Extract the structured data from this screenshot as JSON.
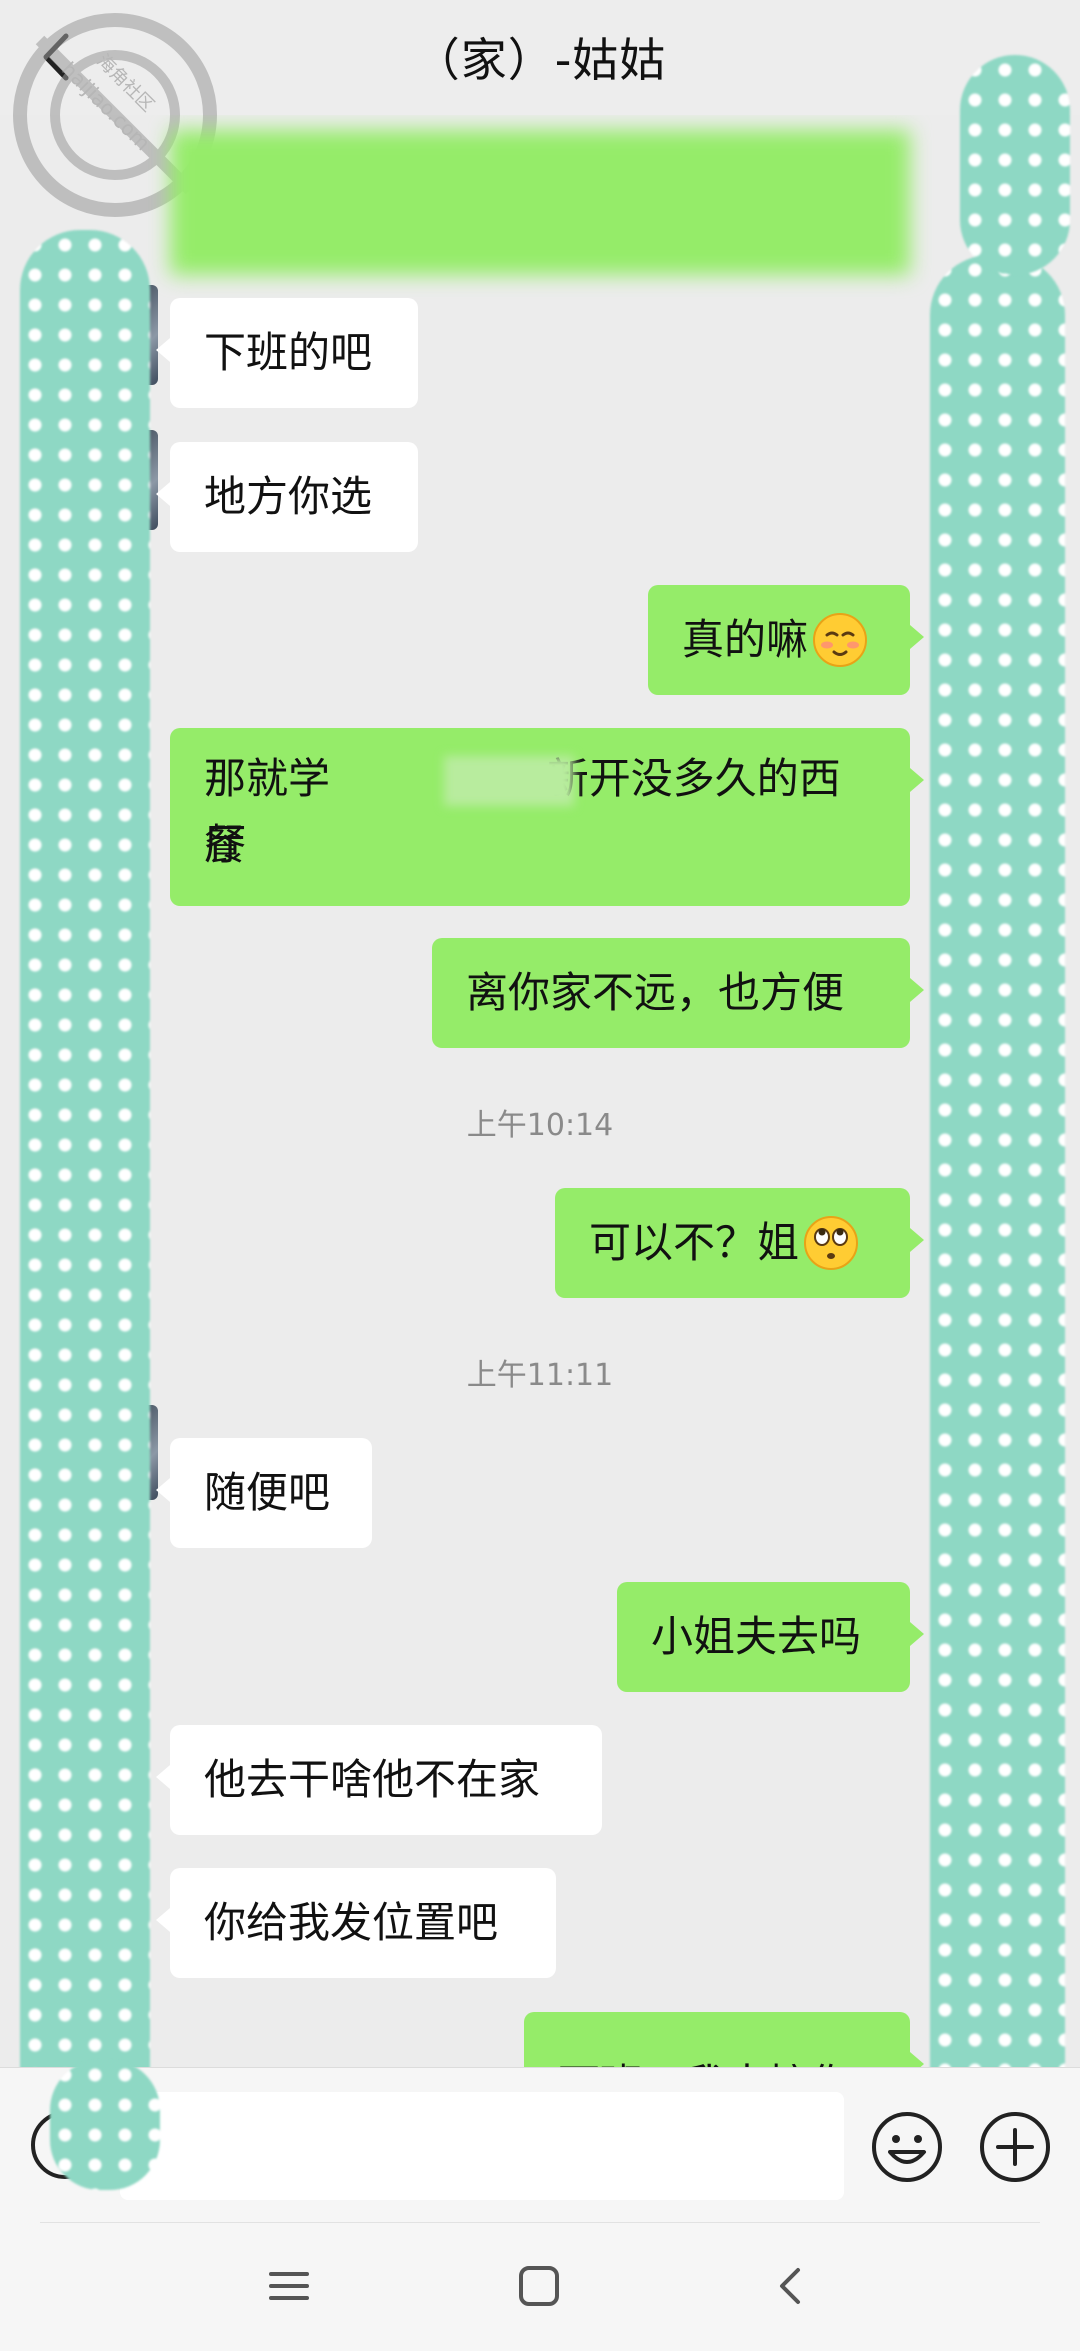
{
  "header": {
    "title": "（家）-姑姑"
  },
  "watermark": {
    "text_top": "海角社区",
    "text_bottom": "haijiao.com"
  },
  "messages": [
    {
      "side": "in",
      "text": "下班的吧"
    },
    {
      "side": "in",
      "text": "地方你选"
    },
    {
      "side": "out",
      "text": "真的嘛",
      "emoji": "smiling-face-with-blush-emoji"
    },
    {
      "side": "out",
      "text_line1a": "那就学",
      "text_line1b": "新开没多久的西餐",
      "text_line2": "厅"
    },
    {
      "side": "out",
      "text": "离你家不远，也方便"
    },
    {
      "side": "out",
      "text": "可以不？姐",
      "emoji": "rolling-eyes-emoji"
    },
    {
      "side": "in",
      "text": "随便吧"
    },
    {
      "side": "out",
      "text": "小姐夫去吗"
    },
    {
      "side": "in",
      "text": "他去干啥他不在家"
    },
    {
      "side": "in",
      "text": "你给我发位置吧"
    },
    {
      "side": "out",
      "text": "下班，我去接你"
    }
  ],
  "timestamps": [
    "上午10:14",
    "上午11:11"
  ],
  "input": {
    "placeholder": ""
  },
  "icons": {
    "back": "chevron-left-icon",
    "voice": "voice-icon",
    "emoji": "emoji-icon",
    "plus": "plus-icon",
    "nav_menu": "menu-icon",
    "nav_home": "home-icon",
    "nav_back": "back-icon"
  },
  "colors": {
    "outgoing_bubble": "#95ec69",
    "incoming_bubble": "#ffffff",
    "chat_background": "#ececec",
    "censor_pattern": "#8ed8c4"
  }
}
